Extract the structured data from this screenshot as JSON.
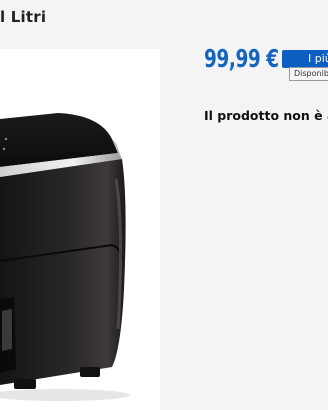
{
  "product": {
    "title": "l Litri",
    "price": "99,99 €",
    "availability": "Il prodotto non è al"
  },
  "cta": {
    "label": "I più",
    "tooltip": "Disponibili"
  },
  "colors": {
    "price": "#1565c0",
    "cta_background": "#0d5fc1",
    "page_background": "#f4f4f4"
  }
}
